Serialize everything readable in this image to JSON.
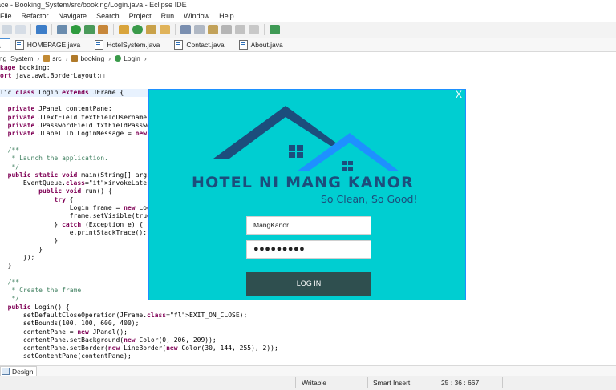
{
  "window": {
    "title": "ace - Booking_System/src/booking/Login.java - Eclipse IDE"
  },
  "menu": [
    "File",
    "Refactor",
    "Navigate",
    "Search",
    "Project",
    "Run",
    "Window",
    "Help"
  ],
  "editor_tabs": [
    {
      "label": "a",
      "active": true
    },
    {
      "label": "HOMEPAGE.java",
      "active": false
    },
    {
      "label": "HotelSystem.java",
      "active": false
    },
    {
      "label": "Contact.java",
      "active": false
    },
    {
      "label": "About.java",
      "active": false
    }
  ],
  "breadcrumb": [
    "ing_System",
    "src",
    "booking",
    "Login"
  ],
  "code_lines": [
    "kage booking;",
    "ort java.awt.BorderLayout;□",
    "",
    "lic class Login extends JFrame {",
    "",
    "  private JPanel contentPane;",
    "  private JTextField textFieldUsername;",
    "  private JPasswordField txtFieldPassword",
    "  private JLabel lblLoginMessage = new JL",
    "",
    "  /**",
    "   * Launch the application.",
    "   */",
    "  public static void main(String[] args)",
    "      EventQueue.invokeLater(new Runnable",
    "          public void run() {",
    "              try {",
    "                  Login frame = new Login",
    "                  frame.setVisible(true);",
    "              } catch (Exception e) {",
    "                  e.printStackTrace();",
    "              }",
    "          }",
    "      });",
    "  }",
    "",
    "  /**",
    "   * Create the frame.",
    "   */",
    "  public Login() {",
    "      setDefaultCloseOperation(JFrame.EXIT_ON_CLOSE);",
    "      setBounds(100, 100, 600, 400);",
    "      contentPane = new JPanel();",
    "      contentPane.setBackground(new Color(0, 206, 209));",
    "      contentPane.setBorder(new LineBorder(new Color(30, 144, 255), 2));",
    "      setContentPane(contentPane);",
    "      contentPane.setLayout(null);"
  ],
  "login_window": {
    "close_symbol": "X",
    "hotel_name": "HOTEL NI MANG KANOR",
    "tagline": "So Clean, So Good!",
    "username_value": "MangKanor",
    "password_value": "●●●●●●●●●",
    "login_button": "LOG IN",
    "colors": {
      "background": "#00ced1",
      "border": "#1e90ff",
      "button": "#2f4f4f",
      "logo_dark": "#1c4d7c",
      "logo_light": "#1e90ff"
    }
  },
  "bottom_tab": "Design",
  "status": {
    "mode": "Writable",
    "insert": "Smart Insert",
    "position": "25 : 36 : 667"
  }
}
